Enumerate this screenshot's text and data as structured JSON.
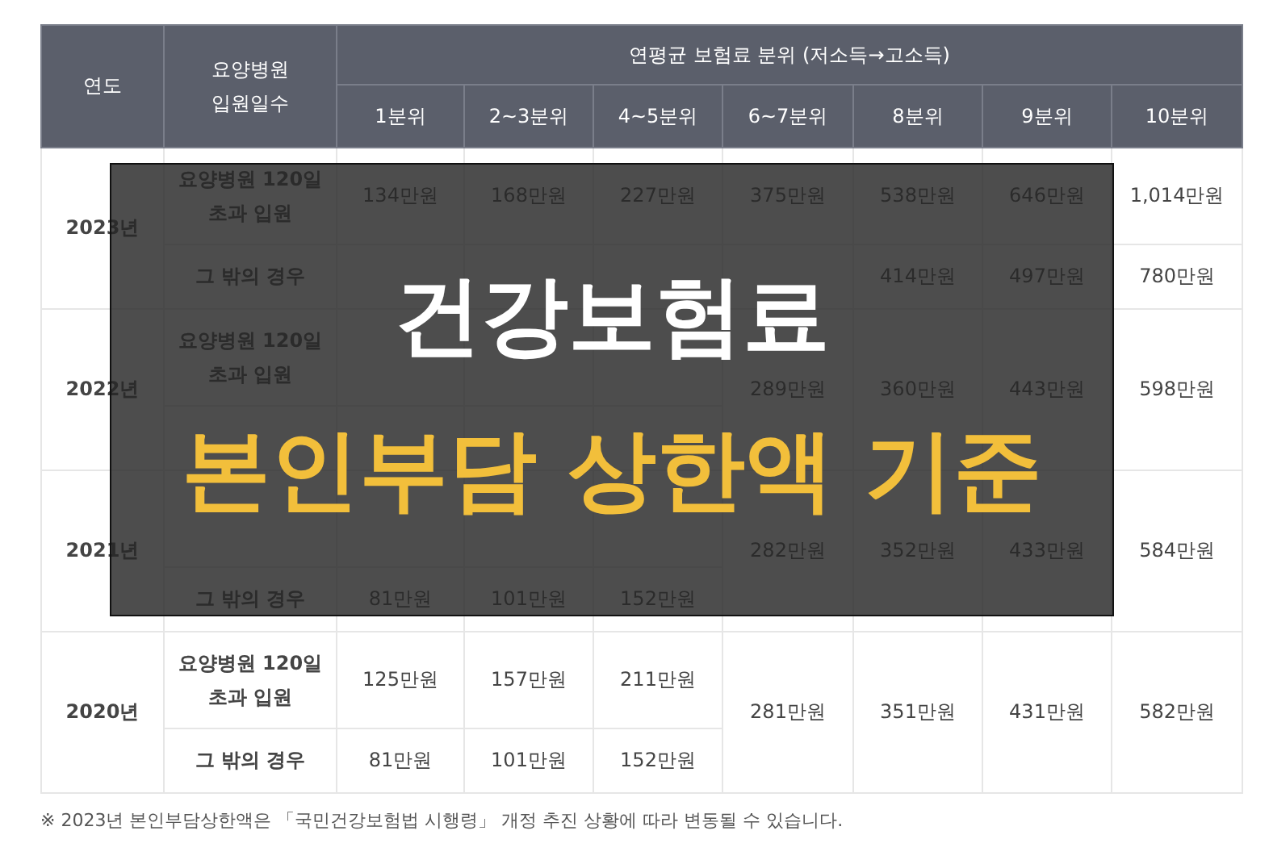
{
  "table": {
    "columns": {
      "year": "연도",
      "stay": "요양병원\n입원일수",
      "group": "연평균 보험료 분위 (저소득→고소득)",
      "deciles": [
        "1분위",
        "2~3분위",
        "4~5분위",
        "6~7분위",
        "8분위",
        "9분위",
        "10분위"
      ]
    },
    "years": [
      {
        "year": "2023년",
        "long_stay": {
          "label": "요양병원 120일\n초과 입원",
          "values": {
            "decile_1": "134만원",
            "decile_2_3": "168만원",
            "decile_4_5": "227만원",
            "decile_6_7": "375만원",
            "decile_8": "538만원",
            "decile_9": "646만원",
            "decile_10": "1,014만원"
          }
        },
        "other": {
          "label": "그 밖의 경우",
          "values": {
            "decile_8": "414만원",
            "decile_9": "497만원",
            "decile_10": "780만원"
          }
        }
      },
      {
        "year": "2022년",
        "long_stay": {
          "label": "요양병원 120일\n초과 입원"
        },
        "shared_values": {
          "decile_6_7": "289만원",
          "decile_8": "360만원",
          "decile_9": "443만원",
          "decile_10": "598만원"
        }
      },
      {
        "year": "2021년",
        "other": {
          "label": "그 밖의 경우",
          "values": {
            "decile_1": "81만원",
            "decile_2_3": "101만원",
            "decile_4_5": "152만원"
          }
        },
        "shared_values": {
          "decile_6_7": "282만원",
          "decile_8": "352만원",
          "decile_9": "433만원",
          "decile_10": "584만원"
        }
      },
      {
        "year": "2020년",
        "long_stay": {
          "label": "요양병원 120일\n초과 입원",
          "values": {
            "decile_1": "125만원",
            "decile_2_3": "157만원",
            "decile_4_5": "211만원"
          }
        },
        "other": {
          "label": "그 밖의 경우",
          "values": {
            "decile_1": "81만원",
            "decile_2_3": "101만원",
            "decile_4_5": "152만원"
          }
        },
        "shared_values": {
          "decile_6_7": "281만원",
          "decile_8": "351만원",
          "decile_9": "431만원",
          "decile_10": "582만원"
        }
      }
    ]
  },
  "footnote": "※ 2023년 본인부담상한액은 「국민건강보험법 시행령」 개정 추진 상황에 따라 변동될 수 있습니다.",
  "banner": {
    "title": "건강보험료",
    "subtitle": "본인부담 상한액 기준"
  }
}
